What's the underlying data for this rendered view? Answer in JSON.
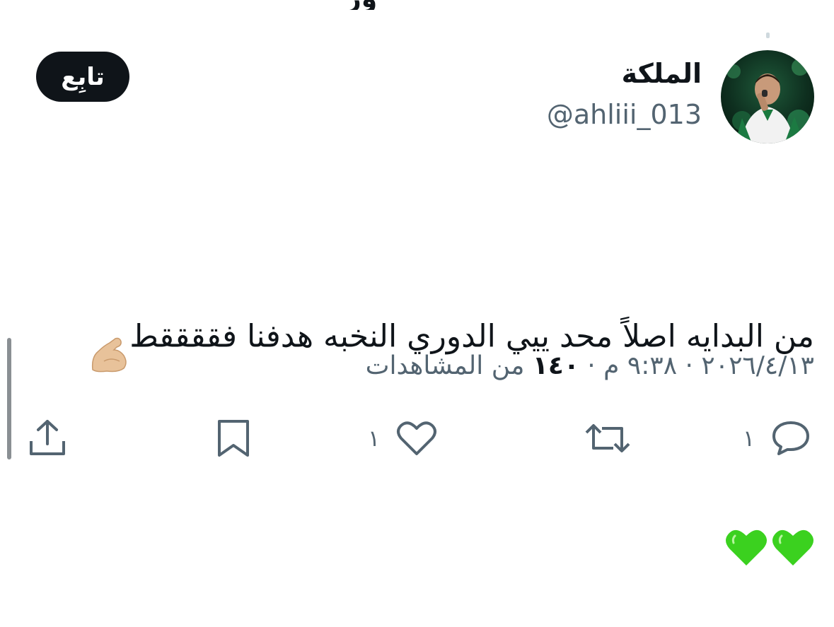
{
  "header": {
    "cut_title": "ور"
  },
  "tweet": {
    "display_name": "الملكة",
    "handle": "@ahliii_013",
    "follow_label": "تابِع",
    "text_line1": "من البدايه اصلاً محد ييي الدوري النخبه هدفنا فققققط",
    "meta_date": "٢٠٢٦/٤/١٣",
    "meta_separator": "·",
    "meta_time": "٩:٣٨ م",
    "meta_views_count": "١٤٠",
    "meta_views_label": "من المشاهدات"
  },
  "actions": {
    "reply_count": "١",
    "like_count": "١"
  },
  "icons": {
    "flex": "flexed-biceps-emoji",
    "heart": "green-heart-emoji",
    "reply": "reply-icon",
    "retweet": "retweet-icon",
    "like": "like-icon",
    "bookmark": "bookmark-icon",
    "share": "share-icon"
  },
  "colors": {
    "text": "#0f1419",
    "secondary": "#536471",
    "follow_bg": "#0f1419",
    "heart_green": "#3bd11f"
  }
}
